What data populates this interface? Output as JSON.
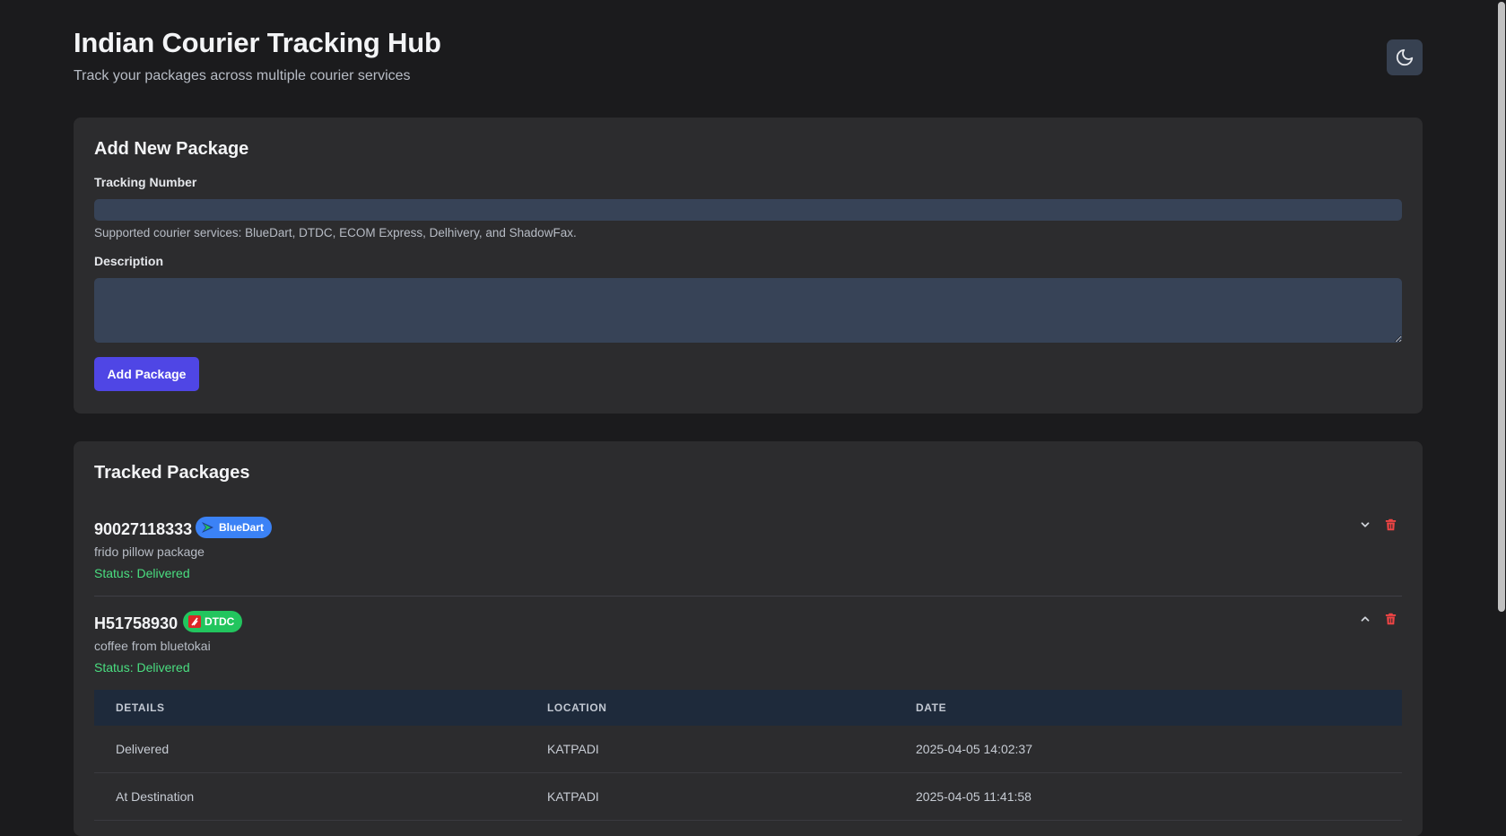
{
  "header": {
    "title": "Indian Courier Tracking Hub",
    "subtitle": "Track your packages across multiple courier services",
    "theme_toggle_icon": "moon-icon"
  },
  "add_package": {
    "title": "Add New Package",
    "tracking_label": "Tracking Number",
    "tracking_value": "",
    "helper_text": "Supported courier services: BlueDart, DTDC, ECOM Express, Delhivery, and ShadowFax.",
    "description_label": "Description",
    "description_value": "",
    "submit_label": "Add Package"
  },
  "tracked": {
    "title": "Tracked Packages",
    "packages": [
      {
        "tracking_number": "90027118333",
        "courier": "BlueDart",
        "courier_color": "#3b82f6",
        "description": "frido pillow package",
        "status": "Status: Delivered",
        "expanded": false,
        "toggle_icon": "chevron-down-icon",
        "delete_icon": "trash-icon"
      },
      {
        "tracking_number": "H51758930",
        "courier": "DTDC",
        "courier_color": "#22c55e",
        "description": "coffee from bluetokai",
        "status": "Status: Delivered",
        "expanded": true,
        "toggle_icon": "chevron-up-icon",
        "delete_icon": "trash-icon",
        "history_headers": [
          "DETAILS",
          "LOCATION",
          "DATE"
        ],
        "history": [
          {
            "details": "Delivered",
            "location": "KATPADI",
            "date": "2025-04-05 14:02:37"
          },
          {
            "details": "At Destination",
            "location": "KATPADI",
            "date": "2025-04-05 11:41:58"
          }
        ]
      }
    ]
  },
  "colors": {
    "background": "#1b1b1d",
    "card": "#2c2c2e",
    "input": "#374357",
    "primary": "#4f46e5",
    "status_delivered": "#4ade80",
    "delete": "#ef4444"
  }
}
